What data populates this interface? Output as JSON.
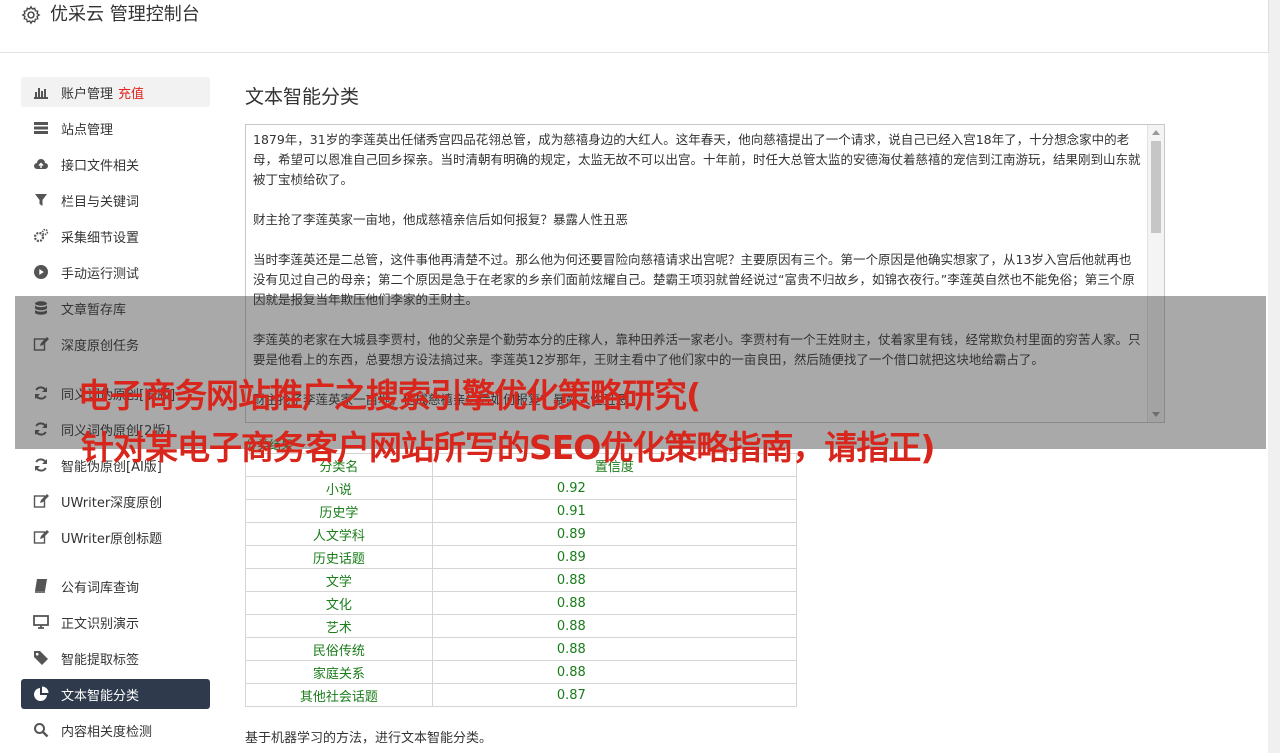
{
  "header": {
    "title": "优采云 管理控制台"
  },
  "sidebar": {
    "recharge_label": "充值",
    "items": [
      {
        "label": "账户管理",
        "icon": "bar-chart-icon"
      },
      {
        "label": "站点管理",
        "icon": "server-icon"
      },
      {
        "label": "接口文件相关",
        "icon": "cloud-upload-icon"
      },
      {
        "label": "栏目与关键词",
        "icon": "filter-icon"
      },
      {
        "label": "采集细节设置",
        "icon": "gears-icon"
      },
      {
        "label": "手动运行测试",
        "icon": "play-icon"
      },
      {
        "label": "文章暂存库",
        "icon": "database-icon"
      },
      {
        "label": "深度原创任务",
        "icon": "edit-icon"
      },
      {
        "label": "同义词伪原创[旧版]",
        "icon": "refresh-icon"
      },
      {
        "label": "同义词伪原创[2版]",
        "icon": "refresh-icon"
      },
      {
        "label": "智能伪原创[AI版]",
        "icon": "refresh-icon"
      },
      {
        "label": "UWriter深度原创",
        "icon": "edit-icon"
      },
      {
        "label": "UWriter原创标题",
        "icon": "edit-icon"
      },
      {
        "label": "公有词库查询",
        "icon": "book-icon"
      },
      {
        "label": "正文识别演示",
        "icon": "monitor-icon"
      },
      {
        "label": "智能提取标签",
        "icon": "tag-icon"
      },
      {
        "label": "文本智能分类",
        "icon": "pie-chart-icon"
      },
      {
        "label": "内容相关度检测",
        "icon": "search-icon"
      }
    ]
  },
  "main": {
    "title": "文本智能分类",
    "text_paragraphs": [
      "1879年，31岁的李莲英出任储秀宫四品花翎总管，成为慈禧身边的大红人。这年春天，他向慈禧提出了一个请求，说自己已经入宫18年了，十分想念家中的老母，希望可以恩准自己回乡探亲。当时清朝有明确的规定，太监无故不可以出宫。十年前，时任大总管太监的安德海仗着慈禧的宠信到江南游玩，结果刚到山东就被丁宝桢给砍了。",
      "财主抢了李莲英家一亩地，他成慈禧亲信后如何报复？暴露人性丑恶",
      "当时李莲英还是二总管，这件事他再清楚不过。那么他为何还要冒险向慈禧请求出宫呢？主要原因有三个。第一个原因是他确实想家了，从13岁入宫后他就再也没有见过自己的母亲；第二个原因是急于在老家的乡亲们面前炫耀自己。楚霸王项羽就曾经说过“富贵不归故乡，如锦衣夜行。”李莲英自然也不能免俗；第三个原因就是报复当年欺压他们李家的王财主。",
      "李莲英的老家在大城县李贾村，他的父亲是个勤劳本分的庄稼人，靠种田养活一家老小。李贾村有一个王姓财主，仗着家里有钱，经常欺负村里面的穷苦人家。只要是他看上的东西，总要想方设法搞过来。李莲英12岁那年，王财主看中了他们家中的一亩良田，然后随便找了一个借口就把这块地给霸占了。",
      "财主抢了李莲英家一亩地，他成慈禧亲信后如何报复？暴露人性丑恶"
    ],
    "result_label": "分类结果",
    "table": {
      "headers": [
        "分类名",
        "置信度"
      ],
      "rows": [
        [
          "小说",
          "0.92"
        ],
        [
          "历史学",
          "0.91"
        ],
        [
          "人文学科",
          "0.89"
        ],
        [
          "历史话题",
          "0.89"
        ],
        [
          "文学",
          "0.88"
        ],
        [
          "文化",
          "0.88"
        ],
        [
          "艺术",
          "0.88"
        ],
        [
          "民俗传统",
          "0.88"
        ],
        [
          "家庭关系",
          "0.88"
        ],
        [
          "其他社会话题",
          "0.87"
        ]
      ]
    },
    "footnote": "基于机器学习的方法，进行文本智能分类。"
  },
  "overlay": {
    "headline_line1": "电子商务网站推广之搜索引擎优化策略研究(",
    "headline_line2": "针对某电子商务客户网站所写的SEO优化策略指南，请指正)"
  },
  "colors": {
    "active_nav_bg": "#2f3b4c",
    "recharge": "#e0231b",
    "result_green": "#1a7d1a",
    "headline_red": "#d8261c"
  }
}
